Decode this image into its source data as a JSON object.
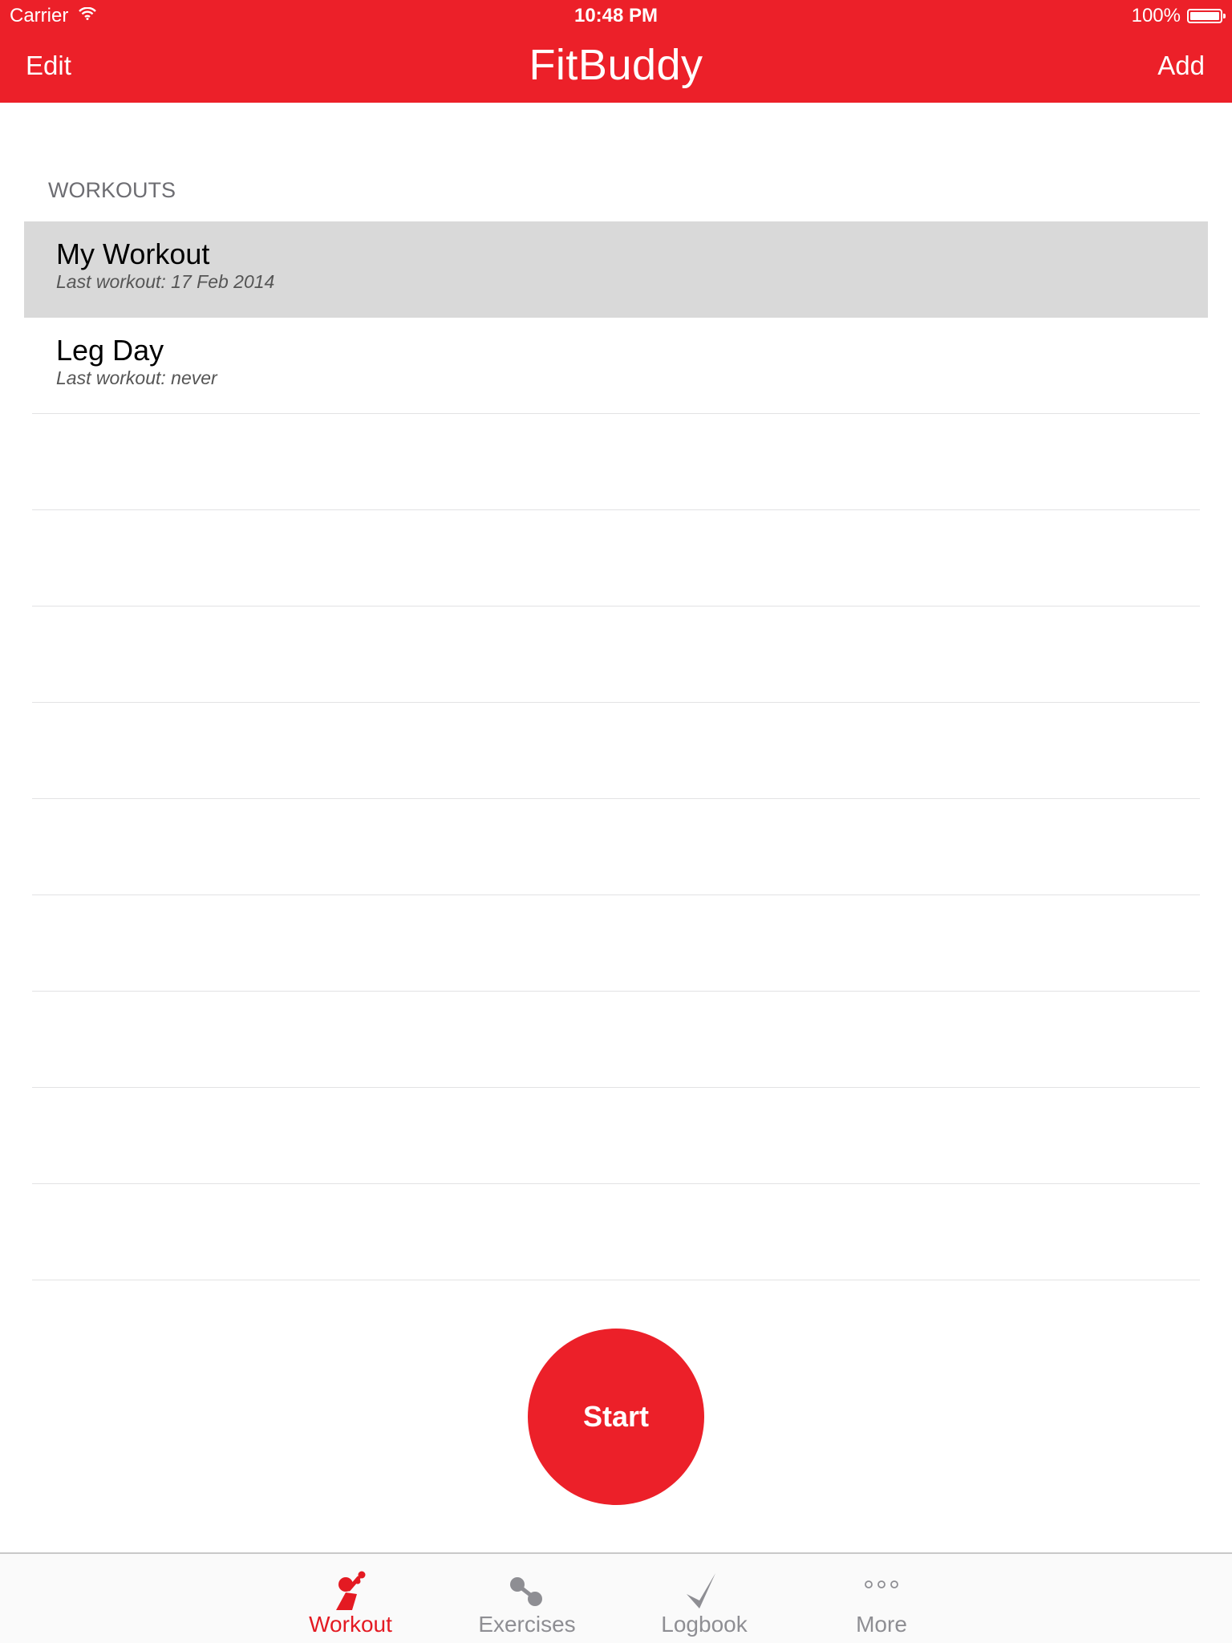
{
  "colors": {
    "accent": "#ec2029",
    "tab_inactive": "#8e8e93",
    "selected_row": "#d9d9d9"
  },
  "status_bar": {
    "carrier": "Carrier",
    "time": "10:48 PM",
    "battery": "100%"
  },
  "nav": {
    "edit_label": "Edit",
    "title": "FitBuddy",
    "add_label": "Add"
  },
  "workouts": {
    "header": "WORKOUTS",
    "items": [
      {
        "title": "My Workout",
        "subtitle": "Last workout:  17 Feb 2014",
        "selected": true
      },
      {
        "title": "Leg Day",
        "subtitle": "Last workout:  never",
        "selected": false
      }
    ]
  },
  "start_button": {
    "label": "Start"
  },
  "tabbar": {
    "tabs": [
      {
        "label": "Workout",
        "icon": "workout-figure-icon",
        "active": true
      },
      {
        "label": "Exercises",
        "icon": "dumbbell-icon",
        "active": false
      },
      {
        "label": "Logbook",
        "icon": "checkmark-icon",
        "active": false
      },
      {
        "label": "More",
        "icon": "more-dots-icon",
        "active": false
      }
    ]
  }
}
